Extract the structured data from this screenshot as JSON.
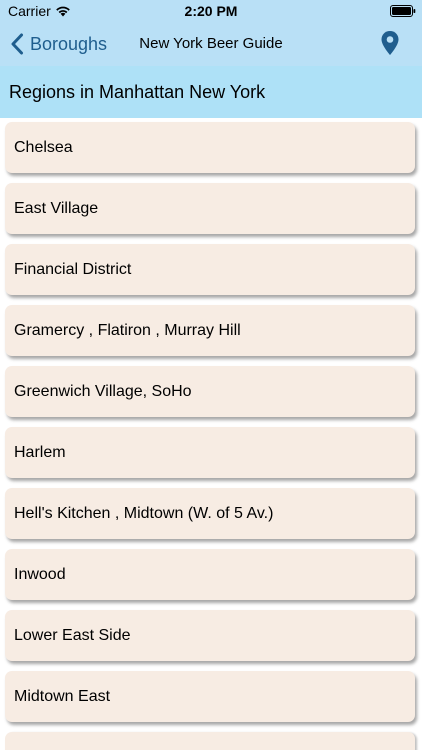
{
  "status_bar": {
    "carrier": "Carrier",
    "time": "2:20 PM",
    "icons": [
      "wifi-icon",
      "battery-icon"
    ]
  },
  "nav": {
    "back_label": "Boroughs",
    "title": "New York Beer Guide",
    "right_icon": "location-pin-icon",
    "tint_color": "#1f5e8e",
    "bar_color": "#b9e0f6"
  },
  "section": {
    "title": "Regions in Manhattan New York",
    "background": "#aee1f7"
  },
  "regions": [
    "Chelsea",
    "East Village",
    "Financial District",
    "Gramercy ,  Flatiron ,  Murray Hill",
    "Greenwich Village, SoHo",
    "Harlem",
    "Hell's Kitchen ,  Midtown (W. of 5 Av.)",
    "Inwood",
    "Lower East Side",
    "Midtown East",
    ""
  ],
  "colors": {
    "row_background": "#f7ece3"
  }
}
